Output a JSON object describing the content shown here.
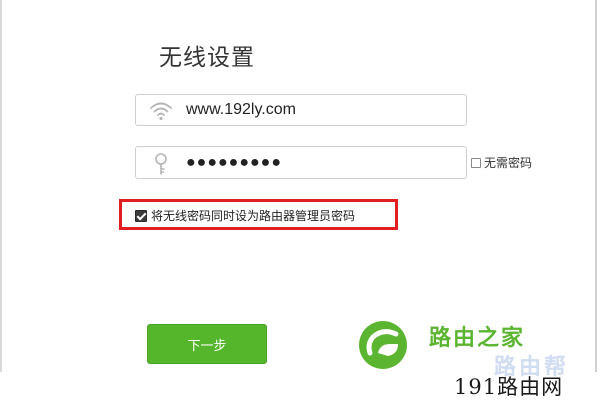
{
  "page": {
    "title": "无线设置"
  },
  "ssid_field": {
    "icon": "wifi-icon",
    "value": "www.192ly.com"
  },
  "password_field": {
    "icon": "key-icon",
    "value": "●●●●●●●●●"
  },
  "no_password_option": {
    "label": "无需密码",
    "checked": false
  },
  "admin_password_option": {
    "label": "将无线密码同时设为路由器管理员密码",
    "checked": true,
    "highlight_color": "#e02020"
  },
  "next_button": {
    "label": "下一步",
    "color": "#55b52b"
  },
  "brand": {
    "logo_icon": "router-home-logo-icon",
    "logo_text": "路由之家",
    "watermark_text": "路由帮",
    "watermark_site": "191路由网",
    "brand_color": "#5bb530"
  }
}
